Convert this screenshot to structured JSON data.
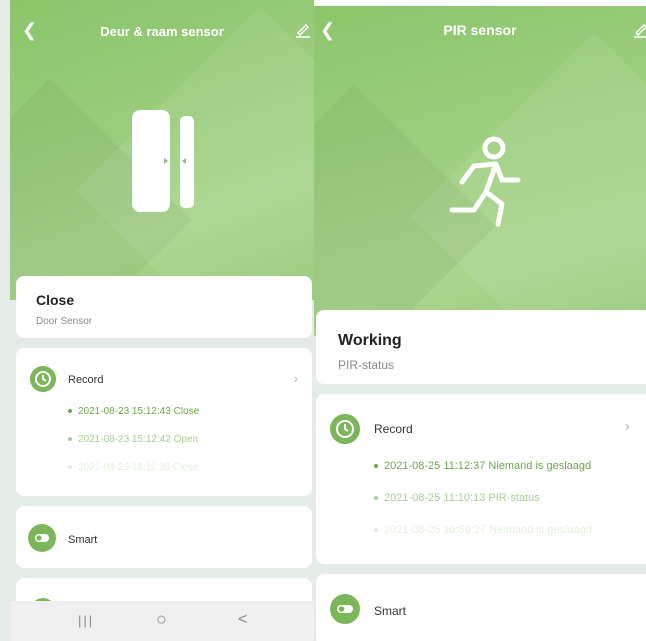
{
  "left": {
    "header": {
      "title": "Deur & raam sensor"
    },
    "status": {
      "title": "Close",
      "subtitle": "Door Sensor"
    },
    "record": {
      "label": "Record",
      "entries": [
        "2021-08-23 15:12:43 Close",
        "2021-08-23 15:12:42 Open",
        "2021-08-23 15:11:36 Close"
      ]
    },
    "smart": {
      "label": "Smart"
    },
    "nav": {
      "recent": "|||",
      "home": "○",
      "back": "<"
    }
  },
  "right": {
    "header": {
      "title": "PIR sensor"
    },
    "status": {
      "title": "Working",
      "subtitle": "PIR-status"
    },
    "record": {
      "label": "Record",
      "entries": [
        "2021-08-25 11:12:37 Niemand is geslaagd",
        "2021-08-25 11:10:13 PIR-status",
        "2021-08-25 10:59:27 Niemand is geslaagd"
      ]
    },
    "smart": {
      "label": "Smart"
    }
  },
  "colors": {
    "accent": "#7cb65a",
    "entry_text": "#6aa847"
  },
  "icons": [
    "back-arrow-icon",
    "edit-pencil-icon",
    "door-sensor-icon",
    "running-person-icon",
    "clock-icon",
    "toggle-icon",
    "chevron-right-icon"
  ]
}
